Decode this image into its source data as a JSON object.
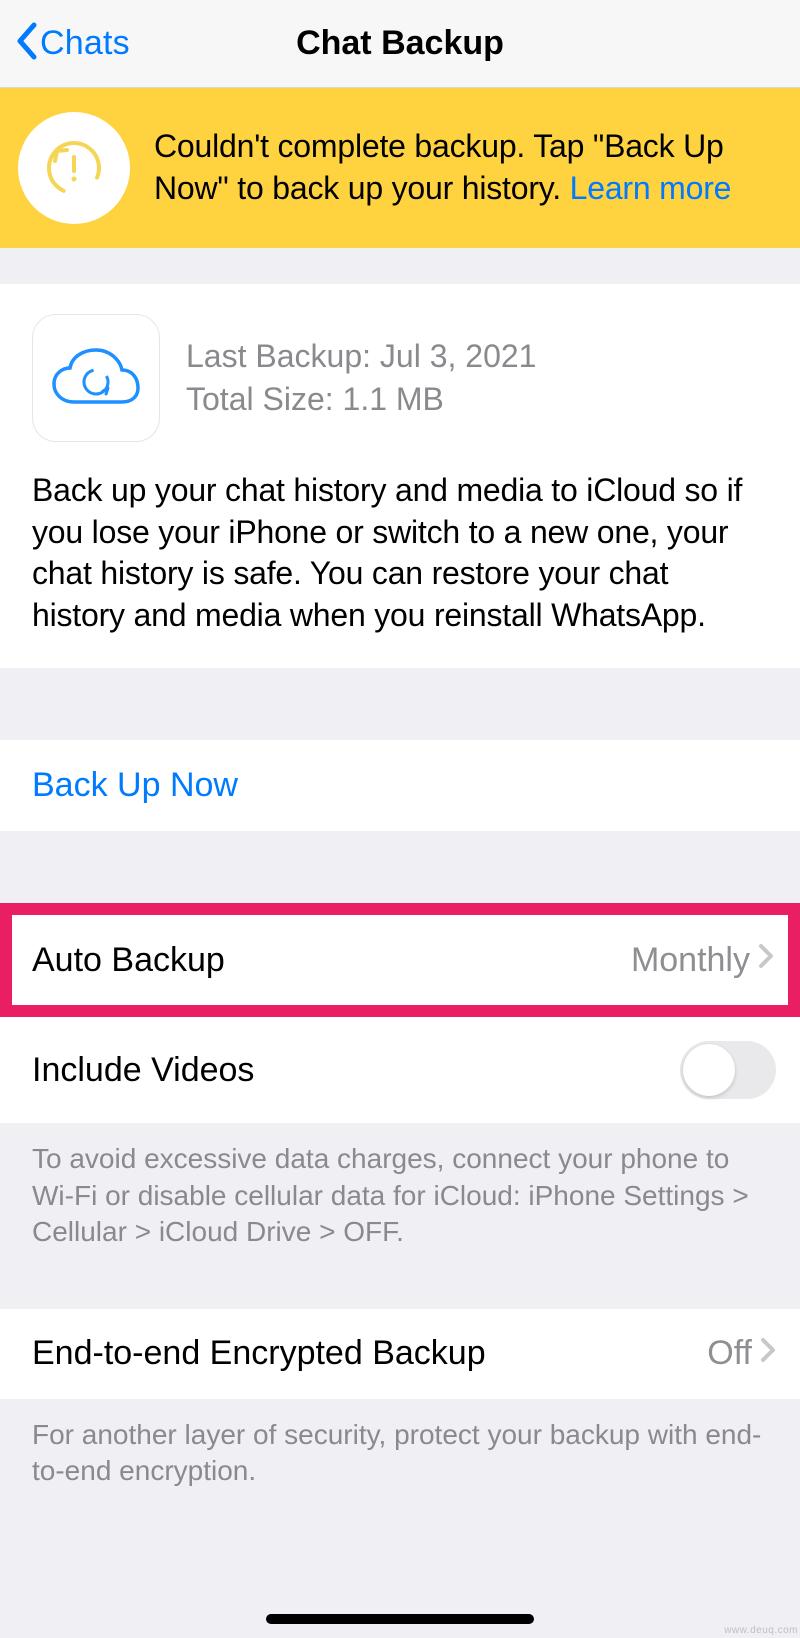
{
  "header": {
    "back_label": "Chats",
    "title": "Chat Backup"
  },
  "banner": {
    "text_main": "Couldn't complete backup. Tap \"Back Up Now\" to back up your history. ",
    "link_label": "Learn more"
  },
  "info": {
    "last_backup_label": "Last Backup: ",
    "last_backup_value": "Jul 3, 2021",
    "total_size_label": "Total Size: ",
    "total_size_value": "1.1 MB",
    "description": "Back up your chat history and media to iCloud so if you lose your iPhone or switch to a new one, your chat history is safe. You can restore your chat history and media when you reinstall WhatsApp."
  },
  "actions": {
    "back_up_now": "Back Up Now"
  },
  "rows": {
    "auto_backup": {
      "label": "Auto Backup",
      "value": "Monthly"
    },
    "include_videos": {
      "label": "Include Videos",
      "enabled": false
    },
    "e2e_backup": {
      "label": "End-to-end Encrypted Backup",
      "value": "Off"
    }
  },
  "footers": {
    "data_notice": "To avoid excessive data charges, connect your phone to Wi-Fi or disable cellular data for iCloud: iPhone Settings > Cellular > iCloud Drive > OFF.",
    "e2e_notice": "For another layer of security, protect your backup with end-to-end encryption."
  },
  "watermark": "www.deuq.com"
}
